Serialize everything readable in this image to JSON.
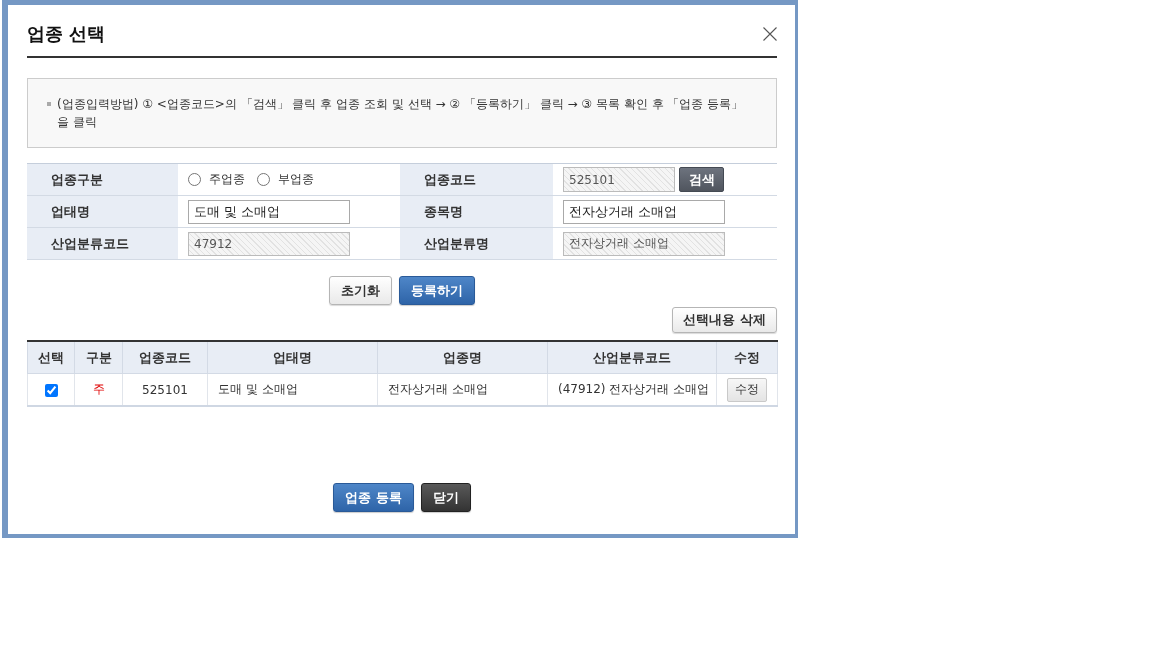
{
  "dialog": {
    "title": "업종 선택"
  },
  "instructions": "(업종입력방법) ① <업종코드>의 「검색」 클릭 후 업종 조회 및 선택 → ② 「등록하기」 클릭 → ③ 목록 확인 후 「업종 등록」을 클릭",
  "form": {
    "fields": [
      {
        "kind": "radio",
        "label": "업종구분",
        "options": [
          {
            "label": "주업종",
            "selected": false
          },
          {
            "label": "부업종",
            "selected": false
          }
        ]
      },
      {
        "kind": "search",
        "label": "업종코드",
        "value": "525101",
        "readonly": true,
        "button": "검색"
      },
      {
        "kind": "input",
        "label": "업태명",
        "value": "도매 및 소매업",
        "readonly": false
      },
      {
        "kind": "input",
        "label": "종목명",
        "value": "전자상거래 소매업",
        "readonly": false
      },
      {
        "kind": "input",
        "label": "산업분류코드",
        "value": "47912",
        "readonly": true
      },
      {
        "kind": "input",
        "label": "산업분류명",
        "value": "전자상거래 소매업",
        "readonly": true
      }
    ],
    "buttons": [
      {
        "label": "초기화",
        "kind": "secondary"
      },
      {
        "label": "등록하기",
        "kind": "primary"
      }
    ]
  },
  "delete_button": "선택내용 삭제",
  "table": {
    "columns": [
      "선택",
      "구분",
      "업종코드",
      "업태명",
      "업종명",
      "산업분류코드",
      "수정"
    ],
    "rows": [
      {
        "cells": [
          {
            "kind": "checkbox",
            "checked": true
          },
          {
            "kind": "type",
            "text": "주"
          },
          {
            "kind": "center",
            "text": "525101"
          },
          {
            "kind": "text",
            "text": "도매 및 소매업"
          },
          {
            "kind": "text",
            "text": "전자상거래 소매업"
          },
          {
            "kind": "text",
            "text": "(47912) 전자상거래 소매업"
          },
          {
            "kind": "button",
            "text": "수정"
          }
        ]
      }
    ]
  },
  "footer_buttons": [
    {
      "label": "업종 등록",
      "kind": "primary"
    },
    {
      "label": "닫기",
      "kind": "dark"
    }
  ]
}
